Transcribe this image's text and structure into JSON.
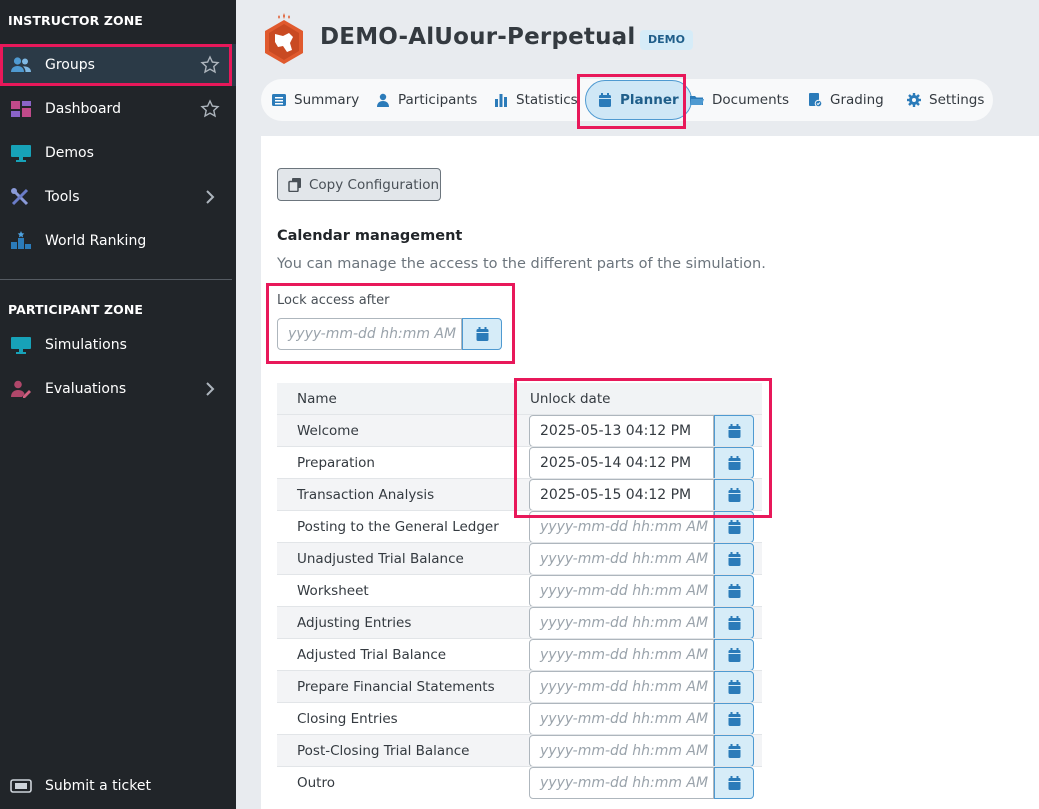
{
  "sidebar": {
    "instructor_zone": "INSTRUCTOR ZONE",
    "instructor_items": [
      {
        "label": "Groups",
        "icon": "users-icon"
      },
      {
        "label": "Dashboard",
        "icon": "dashboard-icon"
      },
      {
        "label": "Demos",
        "icon": "monitor-icon"
      },
      {
        "label": "Tools",
        "icon": "tools-icon"
      },
      {
        "label": "World Ranking",
        "icon": "ranking-icon"
      }
    ],
    "participant_zone": "PARTICIPANT ZONE",
    "participant_items": [
      {
        "label": "Simulations",
        "icon": "monitor-icon"
      },
      {
        "label": "Evaluations",
        "icon": "evaluation-icon"
      }
    ],
    "footer_item": {
      "label": "Submit a ticket",
      "icon": "ticket-icon"
    }
  },
  "header": {
    "title": "DEMO-AlUour-Perpetual",
    "badge": "DEMO"
  },
  "tabs": [
    {
      "label": "Summary",
      "icon": "list-icon"
    },
    {
      "label": "Participants",
      "icon": "user-icon"
    },
    {
      "label": "Statistics",
      "icon": "bar-chart-icon"
    },
    {
      "label": "Planner",
      "icon": "calendar-icon",
      "active": true
    },
    {
      "label": "Documents",
      "icon": "folder-icon"
    },
    {
      "label": "Grading",
      "icon": "grading-icon"
    },
    {
      "label": "Settings",
      "icon": "gear-icon"
    }
  ],
  "planner": {
    "copy_button": "Copy Configuration",
    "calendar_title": "Calendar management",
    "calendar_desc": "You can manage the access to the different parts of the simulation.",
    "lock_label": "Lock access after",
    "date_placeholder": "yyyy-mm-dd hh:mm AM",
    "col_name": "Name",
    "col_unlock": "Unlock date",
    "rows": [
      {
        "name": "Welcome",
        "date": "2025-05-13 04:12 PM"
      },
      {
        "name": "Preparation",
        "date": "2025-05-14 04:12 PM"
      },
      {
        "name": "Transaction Analysis",
        "date": "2025-05-15 04:12 PM"
      },
      {
        "name": "Posting to the General Ledger",
        "date": ""
      },
      {
        "name": "Unadjusted Trial Balance",
        "date": ""
      },
      {
        "name": "Worksheet",
        "date": ""
      },
      {
        "name": "Adjusting Entries",
        "date": ""
      },
      {
        "name": "Adjusted Trial Balance",
        "date": ""
      },
      {
        "name": "Prepare Financial Statements",
        "date": ""
      },
      {
        "name": "Closing Entries",
        "date": ""
      },
      {
        "name": "Post-Closing Trial Balance",
        "date": ""
      },
      {
        "name": "Outro",
        "date": ""
      }
    ]
  },
  "colors": {
    "accent": "#4f9ad1",
    "highlight": "#e8185a",
    "sidebar_bg": "#212529",
    "logo": "#e05a2e"
  }
}
